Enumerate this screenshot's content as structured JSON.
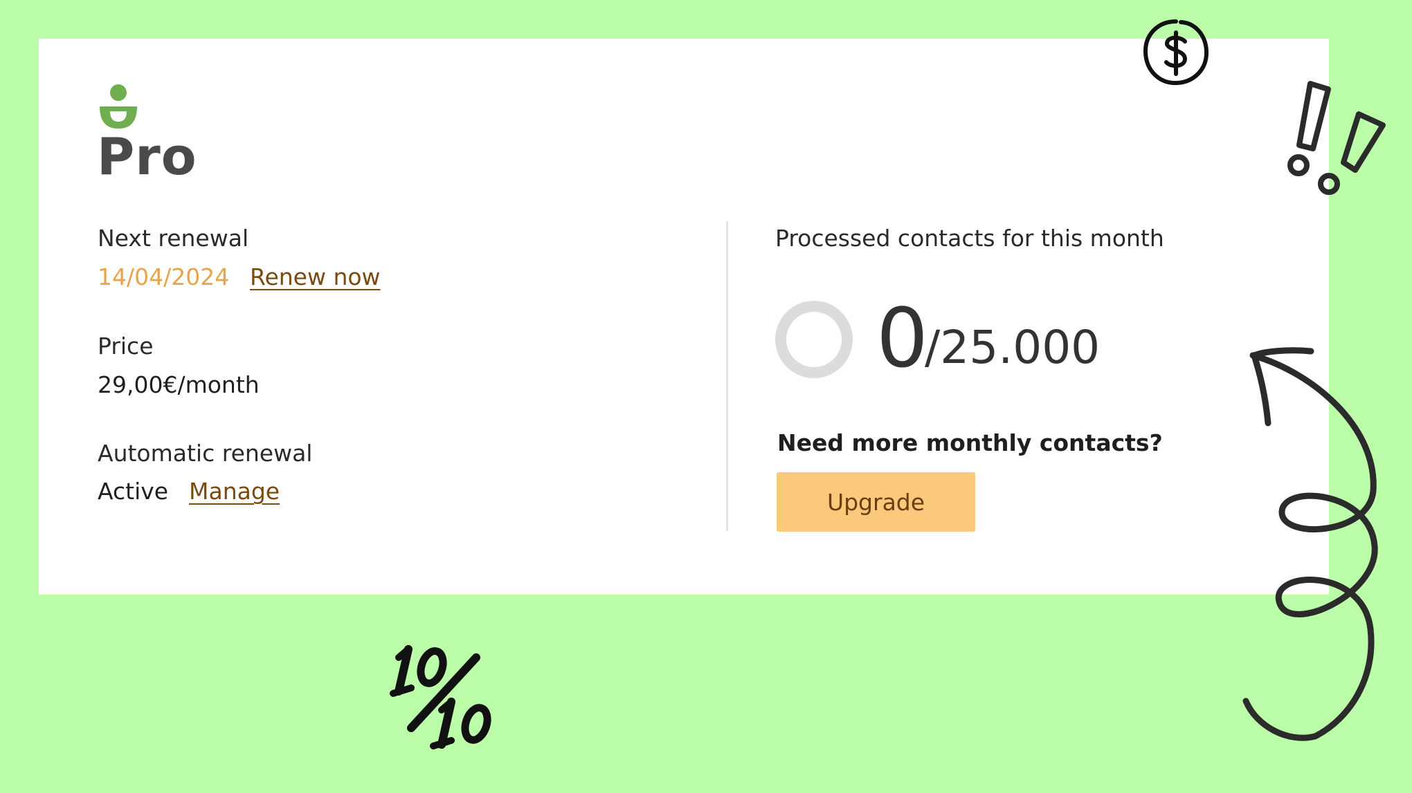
{
  "plan": {
    "name": "Pro",
    "logo_icon": "plan-logo-icon",
    "brand_color": "#6fae4f"
  },
  "details": {
    "next_renewal": {
      "label": "Next renewal",
      "date": "14/04/2024",
      "renew_link": "Renew now"
    },
    "price": {
      "label": "Price",
      "value": "29,00€/month"
    },
    "automatic_renewal": {
      "label": "Automatic renewal",
      "status": "Active",
      "manage_link": "Manage"
    }
  },
  "usage": {
    "title": "Processed contacts for this month",
    "used": "0",
    "total": "/25.000",
    "used_fraction": 0,
    "upgrade_question": "Need more monthly contacts?",
    "upgrade_button": "Upgrade"
  },
  "decorations": {
    "score_text": "10/10",
    "icons": [
      "dollar-icon",
      "exclamation-marks-icon",
      "curly-arrow-icon",
      "ten-out-of-ten-icon"
    ]
  },
  "colors": {
    "background": "#bbfda9",
    "accent": "#fbc97c",
    "date": "#e9a449",
    "link": "#7a4a10"
  }
}
